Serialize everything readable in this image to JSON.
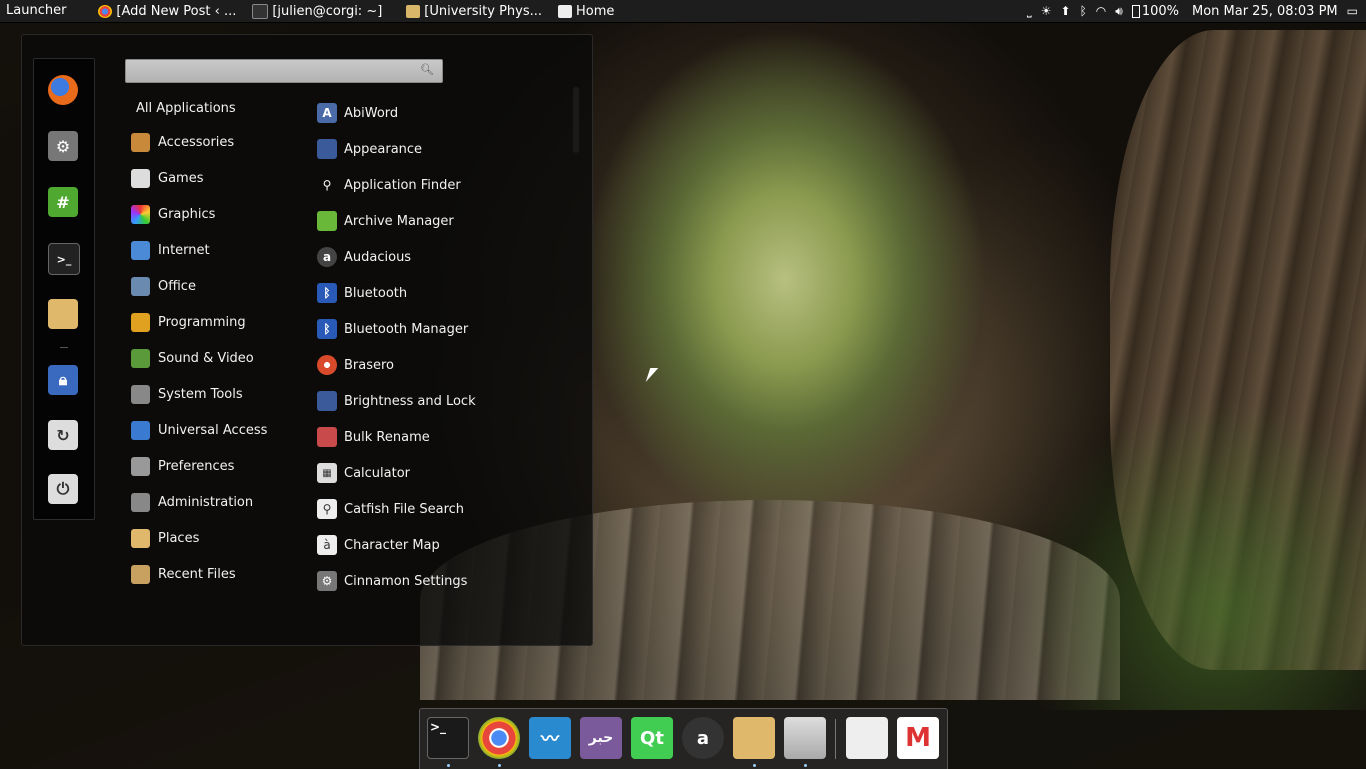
{
  "top_panel": {
    "launcher": "Launcher",
    "windows": [
      {
        "title": "[Add New Post ‹ ...",
        "icon": "chrome-icon"
      },
      {
        "title": "[julien@corgi: ~]",
        "icon": "terminal-icon"
      },
      {
        "title": "[University Phys...",
        "icon": "folder-icon"
      },
      {
        "title": "Home",
        "icon": "notes-icon"
      }
    ],
    "battery": "100%",
    "clock": "Mon Mar 25, 08:03 PM"
  },
  "menu": {
    "search_placeholder": "",
    "favorites": [
      "firefox-icon",
      "settings-icon",
      "hashtag-icon",
      "terminal-icon",
      "folder-icon",
      "lock-screen-icon",
      "logout-icon",
      "power-icon"
    ],
    "categories": [
      {
        "label": "All Applications"
      },
      {
        "label": "Accessories"
      },
      {
        "label": "Games"
      },
      {
        "label": "Graphics"
      },
      {
        "label": "Internet"
      },
      {
        "label": "Office"
      },
      {
        "label": "Programming"
      },
      {
        "label": "Sound & Video"
      },
      {
        "label": "System Tools"
      },
      {
        "label": "Universal Access"
      },
      {
        "label": "Preferences"
      },
      {
        "label": "Administration"
      },
      {
        "label": "Places"
      },
      {
        "label": "Recent Files"
      }
    ],
    "apps": [
      {
        "label": "AbiWord"
      },
      {
        "label": "Appearance"
      },
      {
        "label": "Application Finder"
      },
      {
        "label": "Archive Manager"
      },
      {
        "label": "Audacious"
      },
      {
        "label": "Bluetooth"
      },
      {
        "label": "Bluetooth Manager"
      },
      {
        "label": "Brasero"
      },
      {
        "label": "Brightness and Lock"
      },
      {
        "label": "Bulk Rename"
      },
      {
        "label": "Calculator"
      },
      {
        "label": "Catfish File Search"
      },
      {
        "label": "Character Map"
      },
      {
        "label": "Cinnamon Settings"
      }
    ]
  },
  "dock": {
    "items": [
      {
        "name": "terminal-icon",
        "glyph": ">_"
      },
      {
        "name": "chrome-icon",
        "glyph": ""
      },
      {
        "name": "system-monitor-icon",
        "glyph": ""
      },
      {
        "name": "arabic-app-icon",
        "glyph": ""
      },
      {
        "name": "qt-creator-icon",
        "glyph": "Qt"
      },
      {
        "name": "audacious-icon",
        "glyph": "a"
      },
      {
        "name": "folder-icon",
        "glyph": ""
      },
      {
        "name": "file-cabinet-icon",
        "glyph": ""
      },
      {
        "name": "mail-icon",
        "glyph": ""
      },
      {
        "name": "gmail-icon",
        "glyph": "M"
      }
    ]
  }
}
